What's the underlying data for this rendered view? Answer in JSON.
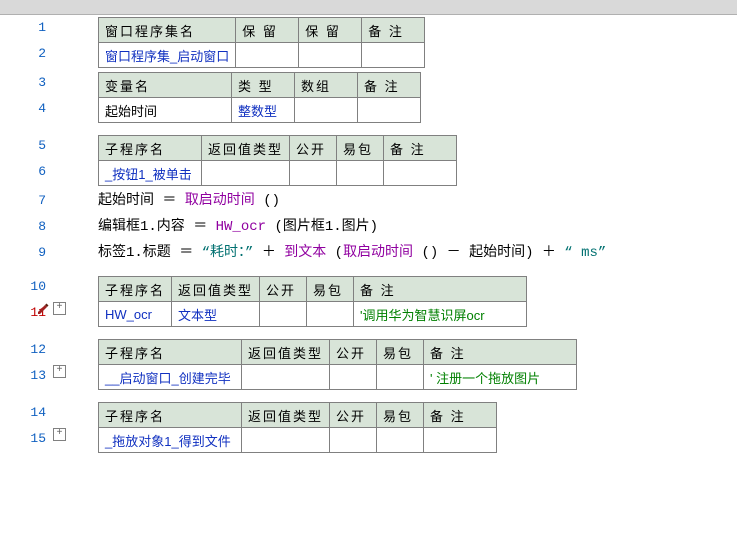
{
  "lines": {
    "l1": "1",
    "l2": "2",
    "l3": "3",
    "l4": "4",
    "l5": "5",
    "l6": "6",
    "l7": "7",
    "l8": "8",
    "l9": "9",
    "l10": "10",
    "l11": "11",
    "l12": "12",
    "l13": "13",
    "l14": "14",
    "l15": "15"
  },
  "expand_glyph": "+",
  "table1": {
    "h1": "窗口程序集名",
    "h2": "保 留",
    "h3": "保 留",
    "h4": "备 注",
    "r1c1": "窗口程序集_启动窗口"
  },
  "table2": {
    "h1": "变量名",
    "h2": "类 型",
    "h3": "数组",
    "h4": "备 注",
    "r1c1": "起始时间",
    "r1c2": "整数型"
  },
  "table3": {
    "h1": "子程序名",
    "h2": "返回值类型",
    "h3": "公开",
    "h4": "易包",
    "h5": "备 注",
    "r1c1": "_按钮1_被单击"
  },
  "code7": {
    "a": "起始时间 ",
    "eq": "＝",
    "b": " ",
    "fn": "取启动时间",
    "c": " ()"
  },
  "code8": {
    "a": "编辑框1.内容 ",
    "eq": "＝",
    "b": " ",
    "fn": "HW_ocr",
    "c": " (图片框1.图片)"
  },
  "code9": {
    "a": "标签1.标题 ",
    "eq": "＝",
    "b": " ",
    "s1": "“耗时：”",
    "p1": " ＋ ",
    "fn1": "到文本",
    "c1": " (",
    "fn2": "取启动时间",
    "c2": " () － 起始时间) ＋ ",
    "s2": "“  ms”"
  },
  "table4": {
    "h1": "子程序名",
    "h2": "返回值类型",
    "h3": "公开",
    "h4": "易包",
    "h5": "备 注",
    "r1c1": "HW_ocr",
    "r1c2": "文本型",
    "r1c5": "'调用华为智慧识屏ocr"
  },
  "table5": {
    "h1": "子程序名",
    "h2": "返回值类型",
    "h3": "公开",
    "h4": "易包",
    "h5": "备 注",
    "r1c1": "__启动窗口_创建完毕",
    "r1c5": "' 注册一个拖放图片"
  },
  "table6": {
    "h1": "子程序名",
    "h2": "返回值类型",
    "h3": "公开",
    "h4": "易包",
    "h5": "备 注",
    "r1c1": "_拖放对象1_得到文件"
  }
}
